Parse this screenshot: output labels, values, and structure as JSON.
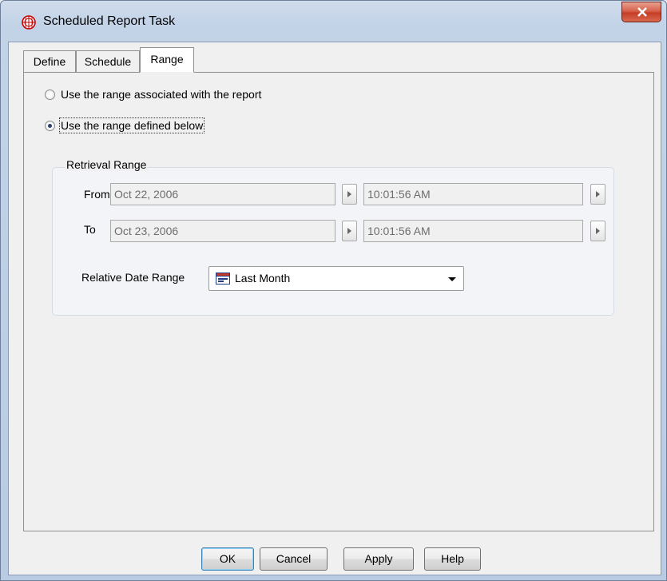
{
  "window": {
    "title": "Scheduled Report Task",
    "close_label": "X"
  },
  "tabs": [
    {
      "label": "Define",
      "active": false
    },
    {
      "label": "Schedule",
      "active": false
    },
    {
      "label": "Range",
      "active": true
    }
  ],
  "range": {
    "option_report": {
      "label": "Use the range associated with the report",
      "checked": false
    },
    "option_defined": {
      "label": "Use the range defined below",
      "checked": true
    },
    "group_title": "Retrieval Range",
    "from": {
      "label": "From",
      "date": "Oct 22, 2006",
      "time": "10:01:56 AM"
    },
    "to": {
      "label": "To",
      "date": "Oct 23, 2006",
      "time": "10:01:56 AM"
    },
    "relative": {
      "label": "Relative Date Range",
      "value": "Last Month"
    }
  },
  "buttons": {
    "ok": "OK",
    "cancel": "Cancel",
    "apply": "Apply",
    "help": "Help"
  },
  "colors": {
    "accent": "#c63d25",
    "frame": "#b9cbe2"
  }
}
